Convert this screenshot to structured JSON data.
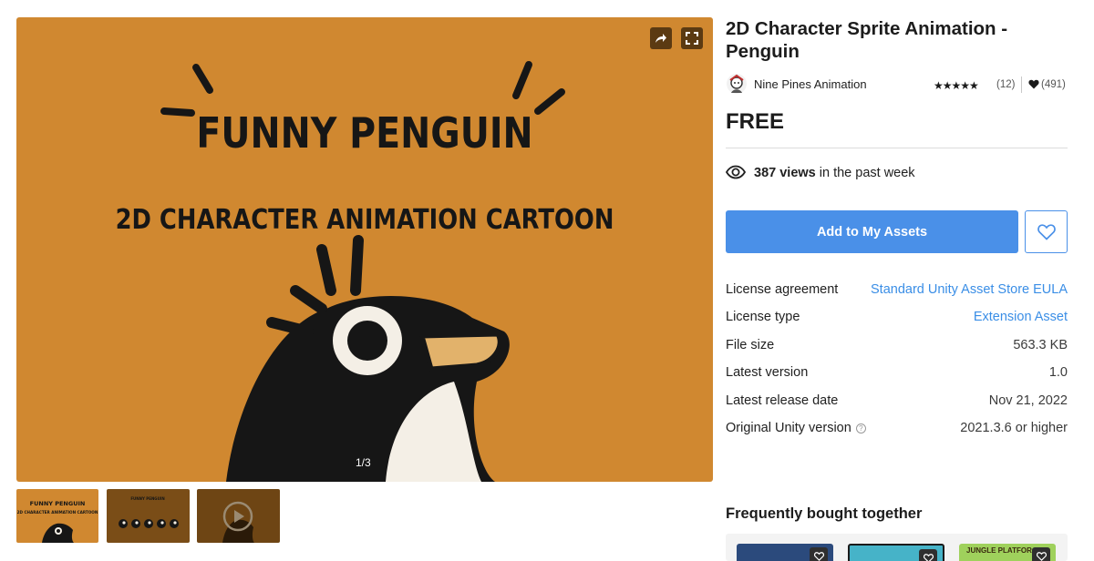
{
  "gallery": {
    "headline": "FUNNY PENGUIN",
    "subheadline": "2D CHARACTER ANIMATION  CARTOON",
    "counter": "1/3",
    "share_icon": "share-arrow-icon",
    "fullscreen_icon": "fullscreen-icon",
    "thumb_a_headline": "FUNNY PENGUIN",
    "thumb_a_subheadline": "2D CHARACTER ANIMATION CARTOON",
    "thumb_b_headline": "FUNNY PENGUIN"
  },
  "product": {
    "title": "2D Character Sprite Animation - Penguin",
    "publisher": "Nine Pines Animation",
    "stars": "★★★★★",
    "rating_count": "(12)",
    "favorites_count": "(491)",
    "price": "FREE",
    "views_count": "387 views",
    "views_suffix": "in the past week",
    "add_button": "Add to My Assets"
  },
  "details": {
    "license_agreement_label": "License agreement",
    "license_agreement_value": "Standard Unity Asset Store EULA",
    "license_type_label": "License type",
    "license_type_value": "Extension Asset",
    "file_size_label": "File size",
    "file_size_value": "563.3 KB",
    "latest_version_label": "Latest version",
    "latest_version_value": "1.0",
    "release_date_label": "Latest release date",
    "release_date_value": "Nov 21, 2022",
    "unity_version_label": "Original Unity version",
    "unity_version_help": "?",
    "unity_version_value": "2021.3.6 or higher"
  },
  "frequently_bought": {
    "title": "Frequently bought together",
    "card3_label": "JUNGLE PLATFOR"
  },
  "colors": {
    "gallery_bg": "#d08830",
    "accent_blue": "#4a90e8",
    "link_blue": "#3a8ee6"
  }
}
